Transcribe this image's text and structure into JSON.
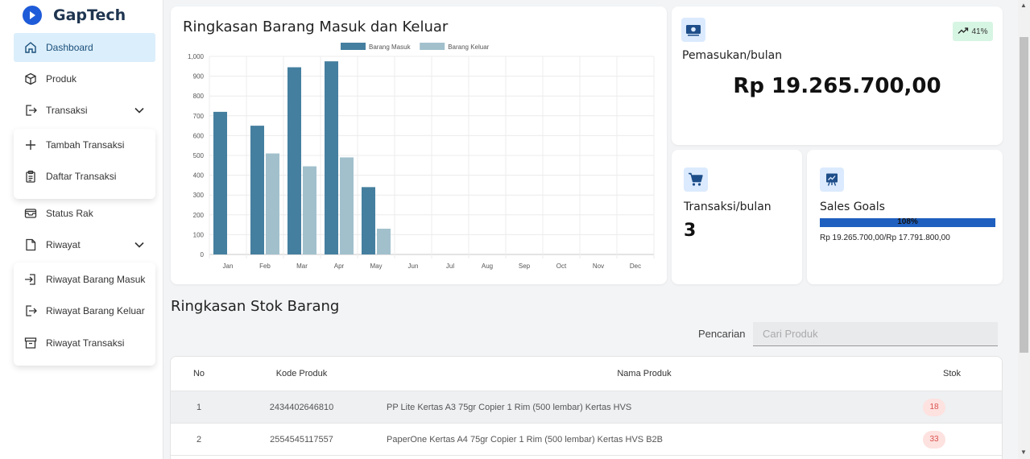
{
  "brand": {
    "name": "GapTech"
  },
  "sidebar": {
    "items": [
      {
        "label": "Dashboard",
        "icon": "home-icon",
        "active": true
      },
      {
        "label": "Produk",
        "icon": "box-icon"
      },
      {
        "label": "Transaksi",
        "icon": "logout-icon",
        "expanded": true,
        "children": [
          {
            "label": "Tambah Transaksi",
            "icon": "plus-icon"
          },
          {
            "label": "Daftar Transaksi",
            "icon": "clipboard-icon"
          }
        ]
      },
      {
        "label": "Status Rak",
        "icon": "inbox-icon"
      },
      {
        "label": "Riwayat",
        "icon": "file-icon",
        "expanded": true,
        "children": [
          {
            "label": "Riwayat Barang Masuk",
            "icon": "login-icon"
          },
          {
            "label": "Riwayat Barang Keluar",
            "icon": "logout-icon"
          },
          {
            "label": "Riwayat Transaksi",
            "icon": "archive-icon"
          }
        ]
      }
    ]
  },
  "chart": {
    "title": "Ringkasan Barang Masuk dan Keluar"
  },
  "chart_data": {
    "type": "bar",
    "title": "Ringkasan Barang Masuk dan Keluar",
    "categories": [
      "Jan",
      "Feb",
      "Mar",
      "Apr",
      "May",
      "Jun",
      "Jul",
      "Aug",
      "Sep",
      "Oct",
      "Nov",
      "Dec"
    ],
    "series": [
      {
        "name": "Barang Masuk",
        "color": "#457f9f",
        "values": [
          720,
          650,
          945,
          975,
          340,
          0,
          0,
          0,
          0,
          0,
          0,
          0
        ]
      },
      {
        "name": "Barang Keluar",
        "color": "#a1c0cc",
        "values": [
          0,
          510,
          445,
          490,
          130,
          0,
          0,
          0,
          0,
          0,
          0,
          0
        ]
      }
    ],
    "ylim": [
      0,
      1000
    ],
    "yticks": [
      "0",
      "100",
      "200",
      "300",
      "400",
      "500",
      "600",
      "700",
      "800",
      "900",
      "1,000"
    ],
    "grid": true,
    "legend": "top-center"
  },
  "income": {
    "label": "Pemasukan/bulan",
    "value": "Rp 19.265.700,00",
    "trend": "41%",
    "icon": "money-icon"
  },
  "transactions": {
    "label": "Transaksi/bulan",
    "value": "3",
    "icon": "cart-icon"
  },
  "goals": {
    "label": "Sales Goals",
    "percent_text": "108%",
    "percent": 1.0,
    "detail": "Rp 19.265.700,00/Rp 17.791.800,00",
    "icon": "chart-board-icon"
  },
  "stock": {
    "title": "Ringkasan Stok Barang",
    "search_label": "Pencarian",
    "search_placeholder": "Cari Produk",
    "headers": {
      "no": "No",
      "code": "Kode Produk",
      "name": "Nama Produk",
      "stock": "Stok"
    },
    "rows": [
      {
        "no": "1",
        "code": "2434402646810",
        "name": "PP Lite Kertas A3 75gr Copier 1 Rim (500 lembar) Kertas HVS",
        "stock": "18"
      },
      {
        "no": "2",
        "code": "2554545117557",
        "name": "PaperOne Kertas A4 75gr Copier 1 Rim (500 lembar) Kertas HVS B2B",
        "stock": "33"
      }
    ]
  },
  "colors": {
    "accent": "#1f5fbf",
    "active_nav": "#dbeefb",
    "trend_badge": "#d7f5e3",
    "stock_badge": "#fde2e0"
  }
}
